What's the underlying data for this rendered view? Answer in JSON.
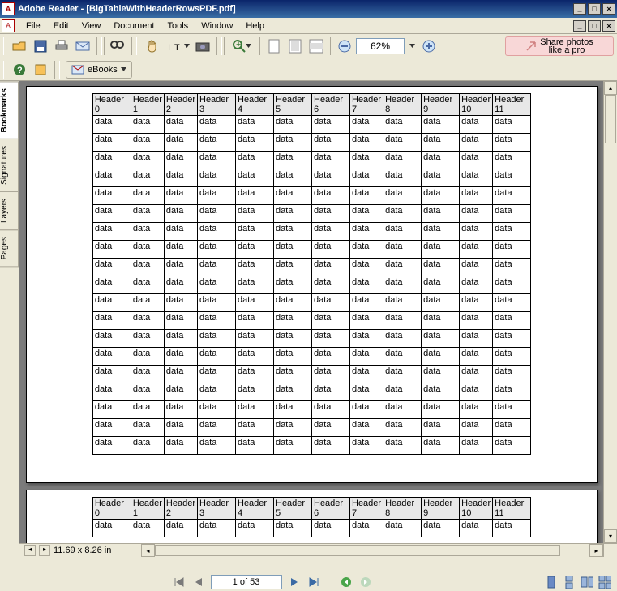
{
  "window": {
    "title": "Adobe Reader - [BigTableWithHeaderRowsPDF.pdf]",
    "min": "_",
    "max": "□",
    "close": "×",
    "doc_min": "_",
    "doc_max": "□",
    "doc_close": "×"
  },
  "menu": {
    "items": [
      "File",
      "Edit",
      "View",
      "Document",
      "Tools",
      "Window",
      "Help"
    ]
  },
  "toolbar": {
    "zoom": "62%",
    "promo_line1": "Share photos",
    "promo_line2": "like a pro",
    "ebooks": "eBooks"
  },
  "sidebar": {
    "tabs": [
      "Bookmarks",
      "Signatures",
      "Layers",
      "Pages"
    ],
    "active": 0
  },
  "document": {
    "headers": [
      "Header 0",
      "Header 1",
      "Header 2",
      "Header 3",
      "Header 4",
      "Header 5",
      "Header 6",
      "Header 7",
      "Header 8",
      "Header 9",
      "Header 10",
      "Header 11"
    ],
    "cell": "data",
    "narrow_cell": "data",
    "main_page_rows": 19,
    "next_page_rows": 1,
    "page_dims": "11.69 x 8.26 in"
  },
  "nav": {
    "page_label": "1 of 53",
    "first": "|◀",
    "prev": "◀",
    "next": "▶",
    "last": "▶|",
    "back": "●",
    "fwd": "●"
  },
  "icons": {
    "open": "open-icon",
    "save": "save-icon",
    "print": "print-icon",
    "mail": "mail-icon",
    "find": "find-icon",
    "hand": "hand-icon",
    "select": "select-text-icon",
    "snapshot": "camera-icon",
    "zoomin": "zoom-in-icon",
    "newdoc": "new-page-icon",
    "fitpage": "fit-page-icon",
    "fitwidth": "fit-width-icon",
    "zoomout": "zoom-out-icon",
    "zoomplus": "zoom-plus-icon",
    "help": "help-icon",
    "review": "review-icon",
    "ebook": "ebook-icon",
    "dropdown": "chevron-down-icon",
    "promo": "promo-arrow-icon"
  }
}
